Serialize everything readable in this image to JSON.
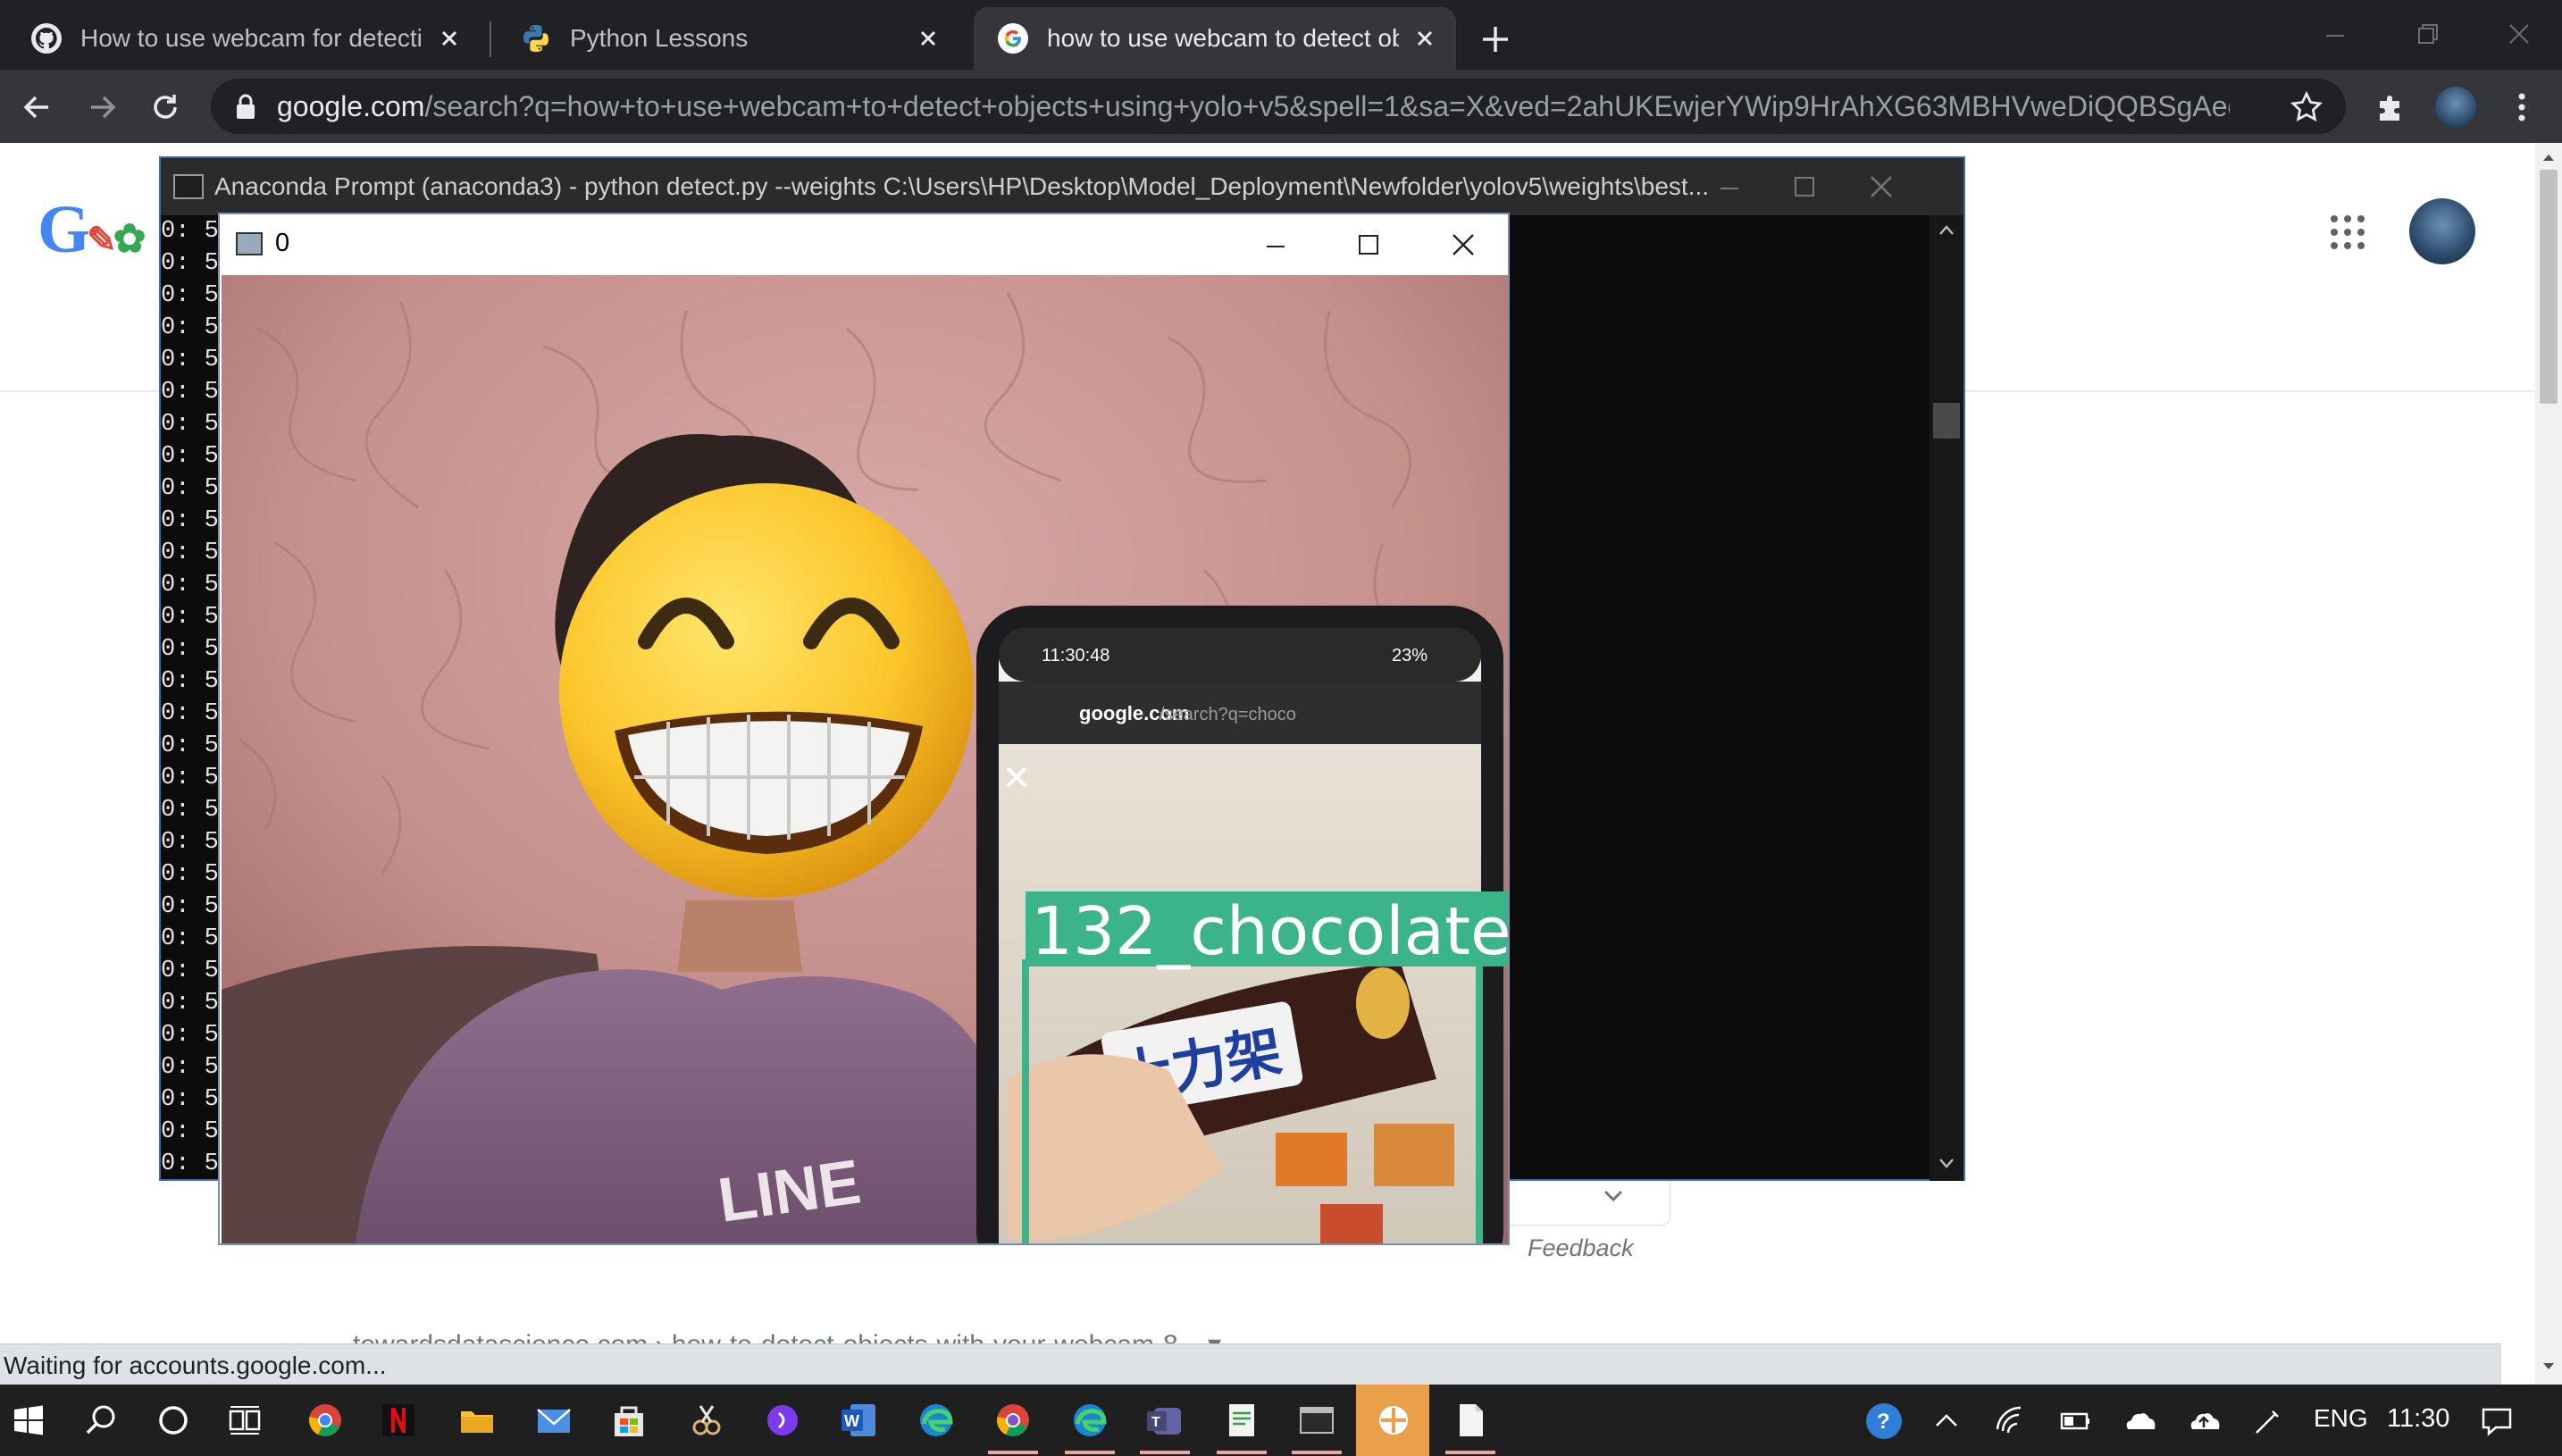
{
  "browser": {
    "tabs": [
      {
        "title": "How to use webcam for detectio",
        "favicon": "github-icon",
        "active": false
      },
      {
        "title": "Python Lessons",
        "favicon": "python-icon",
        "active": false
      },
      {
        "title": "how to use webcam to detect ob",
        "favicon": "google-icon",
        "active": true
      }
    ],
    "url_host": "google.com",
    "url_path": "/search?q=how+to+use+webcam+to+detect+objects+using+yolo+v5&spell=1&sa=X&ved=2ahUKEwjerYWip9HrAhXG63MBHVweDiQQBSgAeg...",
    "status_text": "Waiting for accounts.google.com..."
  },
  "google": {
    "feedback": "Feedback",
    "snippet": "towardsdatascience.com › how-to-detect-objects-with-your-webcam-8... ▾"
  },
  "console": {
    "title": "Anaconda Prompt (anaconda3) - python  detect.py --weights C:\\Users\\HP\\Desktop\\Model_Deployment\\Newfolder\\yolov5\\weights\\best...",
    "lines": [
      "0: 5",
      "0: 5",
      "0: 5",
      "0: 5",
      "0: 5",
      "0: 5",
      "0: 5",
      "0: 5",
      "0: 5",
      "0: 5",
      "0: 5",
      "0: 5",
      "0: 5",
      "0: 5",
      "0: 5",
      "0: 5",
      "0: 5",
      "0: 5",
      "0: 5",
      "0: 5",
      "0: 5",
      "0: 5",
      "0: 5",
      "0: 5",
      "0: 5",
      "0: 5",
      "0: 5",
      "0: 5",
      "0: 5",
      "0: 5"
    ]
  },
  "cv_window": {
    "title": "0",
    "detection_label": "132_chocolate",
    "wrapper_text": "士力架",
    "shirt_text": "LINE",
    "phone": {
      "time": "11:30:48",
      "battery": "23%",
      "url": "google.com",
      "url_path": "/search?q=choco"
    }
  },
  "taskbar": {
    "language": "ENG",
    "time": "11:30"
  },
  "colors": {
    "chrome_dark": "#202124",
    "chrome_toolbar": "#35363a",
    "detection_box": "#3cb48a",
    "console_bg": "#0c0c0c",
    "taskbar_bg": "#1f1f1f"
  }
}
